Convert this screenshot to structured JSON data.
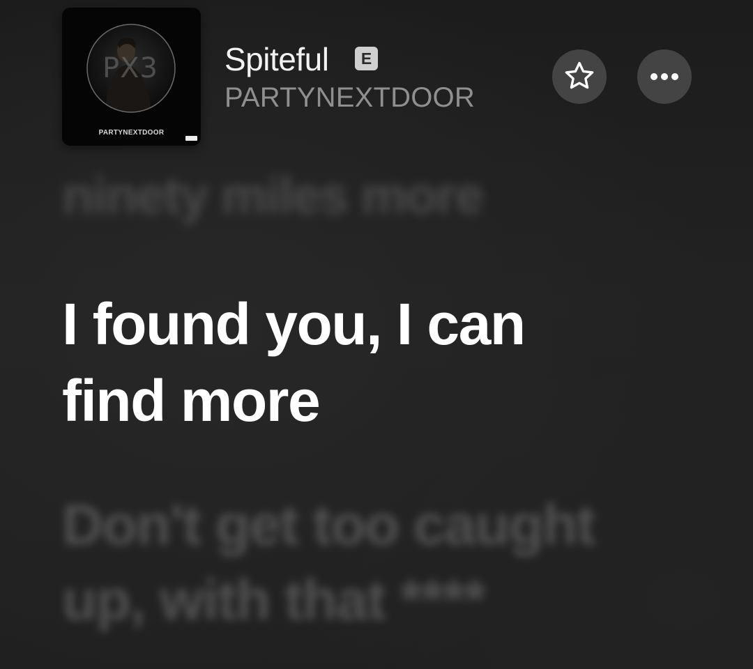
{
  "track": {
    "title": "Spiteful",
    "explicit_badge": "E",
    "artist": "PARTYNEXTDOOR"
  },
  "album_art": {
    "artist_text": "PARTYNEXTDOOR",
    "title_mark": "PX3"
  },
  "actions": {
    "favorite_icon": "star-icon",
    "more_icon": "ellipsis-icon"
  },
  "lyrics": {
    "previous": "ninety miles more",
    "current": [
      "I found you, I can",
      "find more"
    ],
    "next": [
      "Don't get too caught",
      "up, with that ****"
    ]
  },
  "colors": {
    "background": "#1f1f1f",
    "button_bg": "#444444",
    "current_lyric": "#ffffff",
    "inactive_lyric": "#5a5a5a",
    "artist_text": "#8f8f8f"
  }
}
